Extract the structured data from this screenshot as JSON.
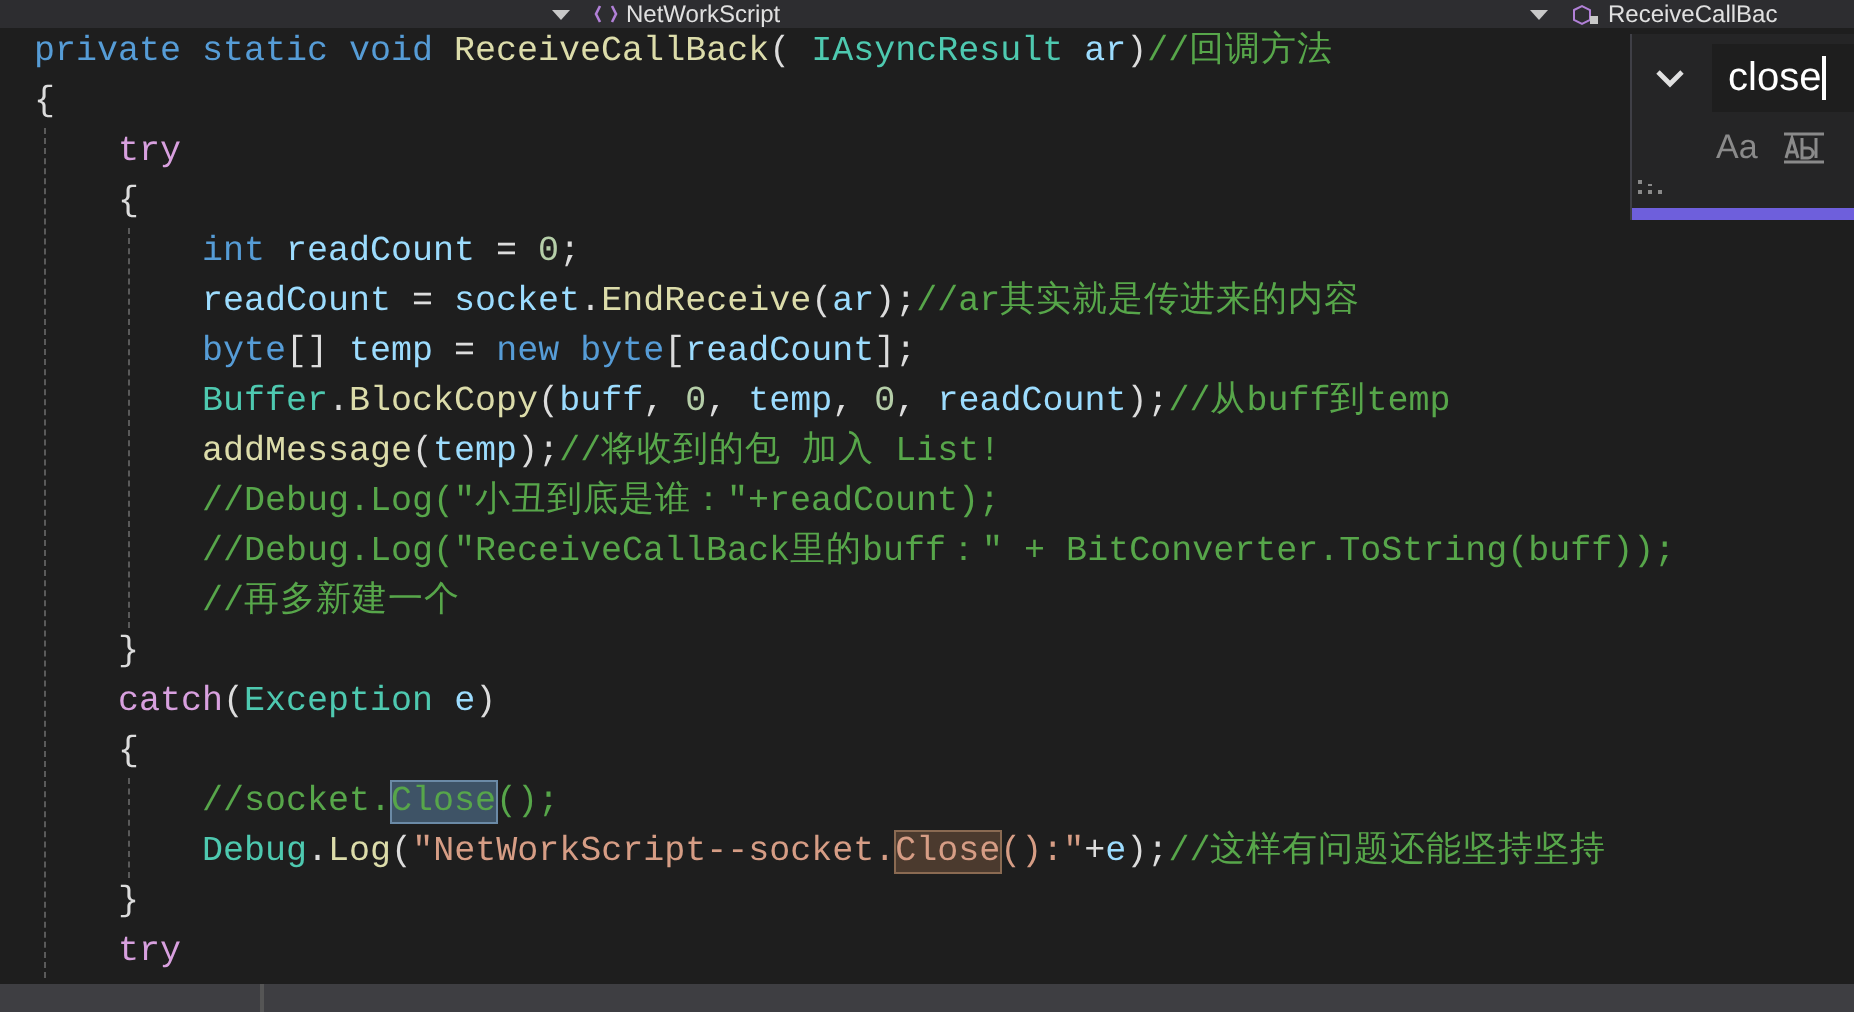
{
  "navigation_bar": {
    "project": "NetWorkScript",
    "member": "ReceiveCallBac"
  },
  "find_widget": {
    "value": "close",
    "match_case_label": "Aa",
    "match_case": false,
    "whole_word": false
  },
  "code_lines": [
    {
      "tokens": [
        {
          "kind": "kw",
          "text": "private static void "
        },
        {
          "kind": "method",
          "text": "ReceiveCallBack"
        },
        {
          "kind": "plain",
          "text": "( "
        },
        {
          "kind": "type",
          "text": "IAsyncResult "
        },
        {
          "kind": "var",
          "text": "ar"
        },
        {
          "kind": "plain",
          "text": ")"
        },
        {
          "kind": "comment",
          "text": "//回调方法"
        }
      ]
    },
    {
      "tokens": [
        {
          "kind": "plain",
          "text": "{"
        }
      ],
      "children": [
        {
          "tokens": [
            {
              "kind": "ctl",
              "text": "try"
            }
          ]
        },
        {
          "tokens": [
            {
              "kind": "plain",
              "text": "{"
            }
          ],
          "children": [
            {
              "tokens": [
                {
                  "kind": "kw",
                  "text": "int "
                },
                {
                  "kind": "var",
                  "text": "readCount"
                },
                {
                  "kind": "plain",
                  "text": " = "
                },
                {
                  "kind": "num",
                  "text": "0"
                },
                {
                  "kind": "plain",
                  "text": ";"
                }
              ]
            },
            {
              "tokens": [
                {
                  "kind": "var",
                  "text": "readCount"
                },
                {
                  "kind": "plain",
                  "text": " = "
                },
                {
                  "kind": "var",
                  "text": "socket"
                },
                {
                  "kind": "plain",
                  "text": "."
                },
                {
                  "kind": "method",
                  "text": "EndReceive"
                },
                {
                  "kind": "plain",
                  "text": "("
                },
                {
                  "kind": "var",
                  "text": "ar"
                },
                {
                  "kind": "plain",
                  "text": ");"
                },
                {
                  "kind": "comment",
                  "text": "//ar其实就是传进来的内容"
                }
              ]
            },
            {
              "tokens": [
                {
                  "kind": "kw",
                  "text": "byte"
                },
                {
                  "kind": "plain",
                  "text": "[] "
                },
                {
                  "kind": "var",
                  "text": "temp"
                },
                {
                  "kind": "plain",
                  "text": " = "
                },
                {
                  "kind": "kw",
                  "text": "new byte"
                },
                {
                  "kind": "plain",
                  "text": "["
                },
                {
                  "kind": "var",
                  "text": "readCount"
                },
                {
                  "kind": "plain",
                  "text": "];"
                }
              ]
            },
            {
              "tokens": [
                {
                  "kind": "type",
                  "text": "Buffer"
                },
                {
                  "kind": "plain",
                  "text": "."
                },
                {
                  "kind": "method",
                  "text": "BlockCopy"
                },
                {
                  "kind": "plain",
                  "text": "("
                },
                {
                  "kind": "var",
                  "text": "buff"
                },
                {
                  "kind": "plain",
                  "text": ", "
                },
                {
                  "kind": "num",
                  "text": "0"
                },
                {
                  "kind": "plain",
                  "text": ", "
                },
                {
                  "kind": "var",
                  "text": "temp"
                },
                {
                  "kind": "plain",
                  "text": ", "
                },
                {
                  "kind": "num",
                  "text": "0"
                },
                {
                  "kind": "plain",
                  "text": ", "
                },
                {
                  "kind": "var",
                  "text": "readCount"
                },
                {
                  "kind": "plain",
                  "text": ");"
                },
                {
                  "kind": "comment",
                  "text": "//从buff到temp"
                }
              ]
            },
            {
              "tokens": [
                {
                  "kind": "method",
                  "text": "addMessage"
                },
                {
                  "kind": "plain",
                  "text": "("
                },
                {
                  "kind": "var",
                  "text": "temp"
                },
                {
                  "kind": "plain",
                  "text": ");"
                },
                {
                  "kind": "comment",
                  "text": "//将收到的包 加入 List!"
                }
              ]
            },
            {
              "tokens": [
                {
                  "kind": "comment",
                  "text": "//Debug.Log(\"小丑到底是谁：\"+readCount);"
                }
              ]
            },
            {
              "tokens": [
                {
                  "kind": "comment",
                  "text": "//Debug.Log(\"ReceiveCallBack里的buff：\" + BitConverter.ToString(buff));"
                }
              ]
            },
            {
              "tokens": [
                {
                  "kind": "comment",
                  "text": "//再多新建一个"
                }
              ]
            }
          ]
        },
        {
          "tokens": [
            {
              "kind": "plain",
              "text": "}"
            }
          ]
        },
        {
          "tokens": [
            {
              "kind": "ctl",
              "text": "catch"
            },
            {
              "kind": "plain",
              "text": "("
            },
            {
              "kind": "type",
              "text": "Exception "
            },
            {
              "kind": "var",
              "text": "e"
            },
            {
              "kind": "plain",
              "text": ")"
            }
          ]
        },
        {
          "tokens": [
            {
              "kind": "plain",
              "text": "{"
            }
          ],
          "children": [
            {
              "tokens": [
                {
                  "kind": "comment",
                  "text": "//socket."
                },
                {
                  "kind": "comment",
                  "text": "Close",
                  "match": true,
                  "current": true
                },
                {
                  "kind": "comment",
                  "text": "();"
                }
              ]
            },
            {
              "tokens": [
                {
                  "kind": "type",
                  "text": "Debug"
                },
                {
                  "kind": "plain",
                  "text": "."
                },
                {
                  "kind": "method",
                  "text": "Log"
                },
                {
                  "kind": "plain",
                  "text": "("
                },
                {
                  "kind": "str",
                  "text": "\"NetWorkScript--socket."
                },
                {
                  "kind": "str",
                  "text": "Close",
                  "match": true,
                  "current": false
                },
                {
                  "kind": "str",
                  "text": "():\""
                },
                {
                  "kind": "plain",
                  "text": "+"
                },
                {
                  "kind": "var",
                  "text": "e"
                },
                {
                  "kind": "plain",
                  "text": ");"
                },
                {
                  "kind": "comment",
                  "text": "//这样有问题还能坚持坚持"
                }
              ]
            }
          ]
        },
        {
          "tokens": [
            {
              "kind": "plain",
              "text": "}"
            }
          ]
        },
        {
          "tokens": [
            {
              "kind": "ctl",
              "text": "try"
            }
          ]
        }
      ]
    }
  ]
}
